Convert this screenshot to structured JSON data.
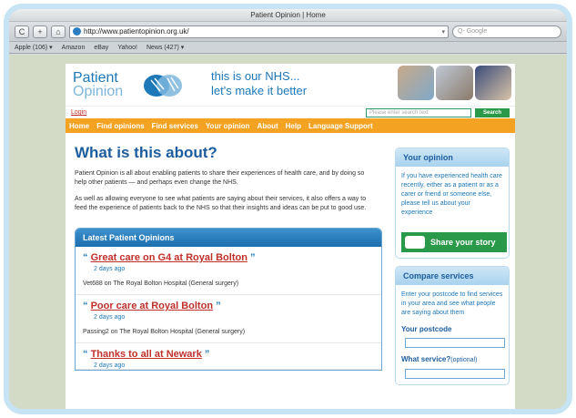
{
  "browser": {
    "title": "Patient Opinion | Home",
    "url": "http://www.patientopinion.org.uk/",
    "search_placeholder": "Q- Google",
    "back": "‹",
    "forward": "›",
    "reload": "C",
    "add": "+",
    "home": "⌂",
    "bookmarks": [
      "Apple (106) ▾",
      "Amazon",
      "eBay",
      "Yahoo!",
      "News (427) ▾"
    ]
  },
  "header": {
    "logo_line1": "Patient",
    "logo_line2": "Opinion",
    "tagline_line1": "this is our NHS...",
    "tagline_line2": "let's make it better"
  },
  "topbar": {
    "login": "Login",
    "search_placeholder": "Please enter search text",
    "search_button": "Search"
  },
  "nav": [
    "Home",
    "Find opinions",
    "Find services",
    "Your opinion",
    "About",
    "Help",
    "Language Support"
  ],
  "main": {
    "heading": "What is this about?",
    "para1": "Patient Opinion is all about enabling patients to share their experiences of health care, and by doing so help other patients — and perhaps even change the NHS.",
    "para2": "As well as allowing everyone to see what patients are saying about their services, it also offers a way to feed the experience of patients back to the NHS so that their insights and ideas can be put to good use."
  },
  "latest": {
    "title": "Latest Patient Opinions",
    "items": [
      {
        "title": "Great care on G4 at Royal Bolton",
        "date": "2 days ago",
        "source": "Vet688 on The Royal Bolton Hospital (General surgery)"
      },
      {
        "title": "Poor care at Royal Bolton",
        "date": "2 days ago",
        "source": "Passing2 on The Royal Bolton Hospital (General surgery)"
      },
      {
        "title": "Thanks to all at Newark",
        "date": "2 days ago",
        "source": ""
      }
    ]
  },
  "sidebar": {
    "your_opinion": {
      "title": "Your opinion",
      "body": "If you have experienced health care recently, either as a patient or as a carer or friend or someone else, please tell us about your experience",
      "button": "Share your story"
    },
    "compare": {
      "title": "Compare services",
      "body": "Enter your postcode to find services in your area and see what people are saying about them",
      "postcode_label": "Your postcode",
      "service_label": "What service?",
      "service_optional": "(optional)"
    }
  },
  "colors": {
    "nav": "#f3a221",
    "brand_blue": "#1c78b8",
    "link_red": "#c0302a",
    "green": "#2a9a4a"
  }
}
